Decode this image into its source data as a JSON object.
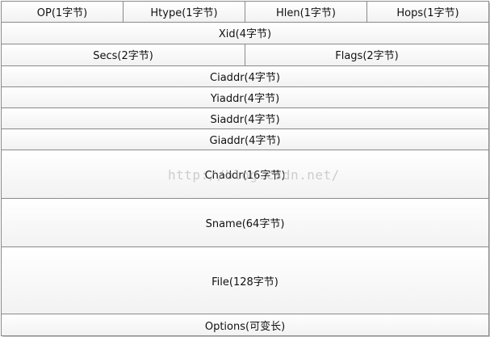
{
  "rows": [
    {
      "cells": [
        "OP(1字节)",
        "Htype(1字节)",
        "Hlen(1字节)",
        "Hops(1字节)"
      ]
    },
    {
      "cells": [
        "Xid(4字节)"
      ]
    },
    {
      "cells": [
        "Secs(2字节)",
        "Flags(2字节)"
      ]
    },
    {
      "cells": [
        "Ciaddr(4字节)"
      ]
    },
    {
      "cells": [
        "Yiaddr(4字节)"
      ]
    },
    {
      "cells": [
        "Siaddr(4字节)"
      ]
    },
    {
      "cells": [
        "Giaddr(4字节)"
      ]
    },
    {
      "cells": [
        "Chaddr(16字节)"
      ]
    },
    {
      "cells": [
        "Sname(64字节)"
      ]
    },
    {
      "cells": [
        "File(128字节)"
      ]
    },
    {
      "cells": [
        "Options(可变长)"
      ]
    }
  ],
  "watermark": "http://blog.csdn.net/"
}
